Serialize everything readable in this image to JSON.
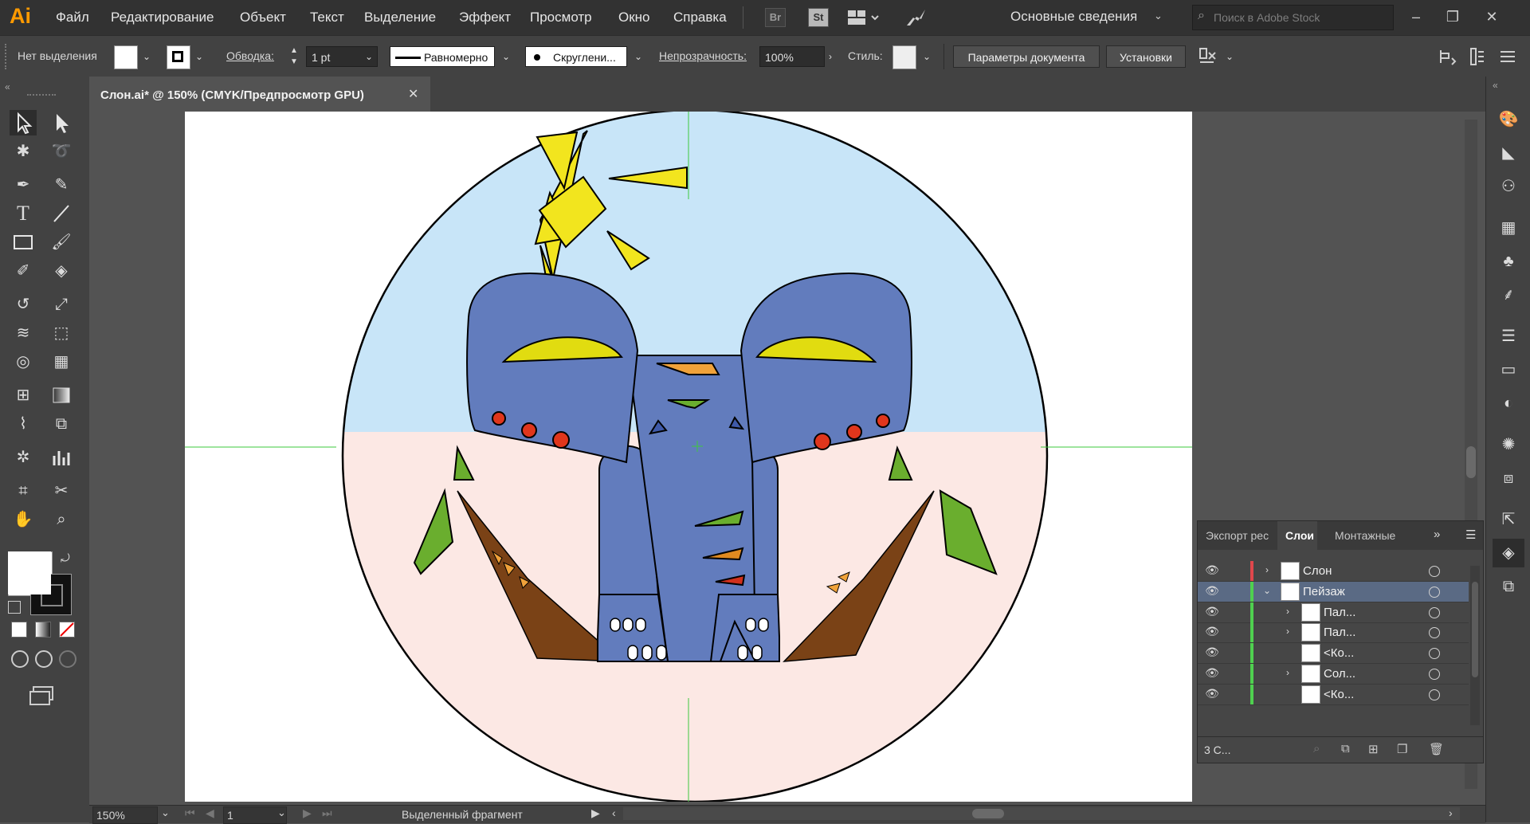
{
  "app": {
    "logo": "Ai"
  },
  "menubar": {
    "items": [
      "Файл",
      "Редактирование",
      "Объект",
      "Текст",
      "Выделение",
      "Эффект",
      "Просмотр",
      "Окно",
      "Справка"
    ],
    "bridge": "Br",
    "stock": "St",
    "workspace": "Основные сведения",
    "stock_search_placeholder": "Поиск в Adobe Stock"
  },
  "controlbar": {
    "no_selection": "Нет выделения",
    "stroke_label": "Обводка:",
    "stroke_value": "1 pt",
    "stroke_profile": "Равномерно",
    "brush": "Скруглени...",
    "opacity_label": "Непрозрачность:",
    "opacity_value": "100%",
    "style_label": "Стиль:",
    "doc_setup_button": "Параметры документа",
    "preferences_button": "Установки"
  },
  "document": {
    "tab_title": "Слон.ai* @ 150% (CMYK/Предпросмотр GPU)",
    "zoom": "150%",
    "artboard_number": "1",
    "status_text": "Выделенный фрагмент"
  },
  "layers_panel": {
    "tabs": [
      "Экспорт рес",
      "Слои",
      "Монтажные"
    ],
    "active_tab": "Слои",
    "rows": [
      {
        "name": "Слон",
        "color": "#e0474c",
        "expanded": false,
        "indent": 0,
        "selected": false
      },
      {
        "name": "Пейзаж",
        "color": "#4fd04f",
        "expanded": true,
        "indent": 0,
        "selected": true
      },
      {
        "name": "Пал...",
        "color": "#4fd04f",
        "expanded": false,
        "indent": 1,
        "selected": false
      },
      {
        "name": "Пал...",
        "color": "#4fd04f",
        "expanded": false,
        "indent": 1,
        "selected": false
      },
      {
        "name": "<Ко...",
        "color": "#4fd04f",
        "expanded": null,
        "indent": 1,
        "selected": false
      },
      {
        "name": "Сол...",
        "color": "#4fd04f",
        "expanded": false,
        "indent": 1,
        "selected": false
      },
      {
        "name": "<Ко...",
        "color": "#4fd04f",
        "expanded": null,
        "indent": 1,
        "selected": false
      }
    ],
    "footer_count": "3 С..."
  },
  "colors": {
    "sky": "#c8e5f8",
    "ground": "#fce8e4",
    "elephant": "#627cbd",
    "sun": "#f2e51e",
    "leaf": "#6aae2e",
    "trunk": "#7a4216",
    "ear_accent": "#e1dc10",
    "dot": "#e0361c",
    "brand": "#ff9a00"
  }
}
